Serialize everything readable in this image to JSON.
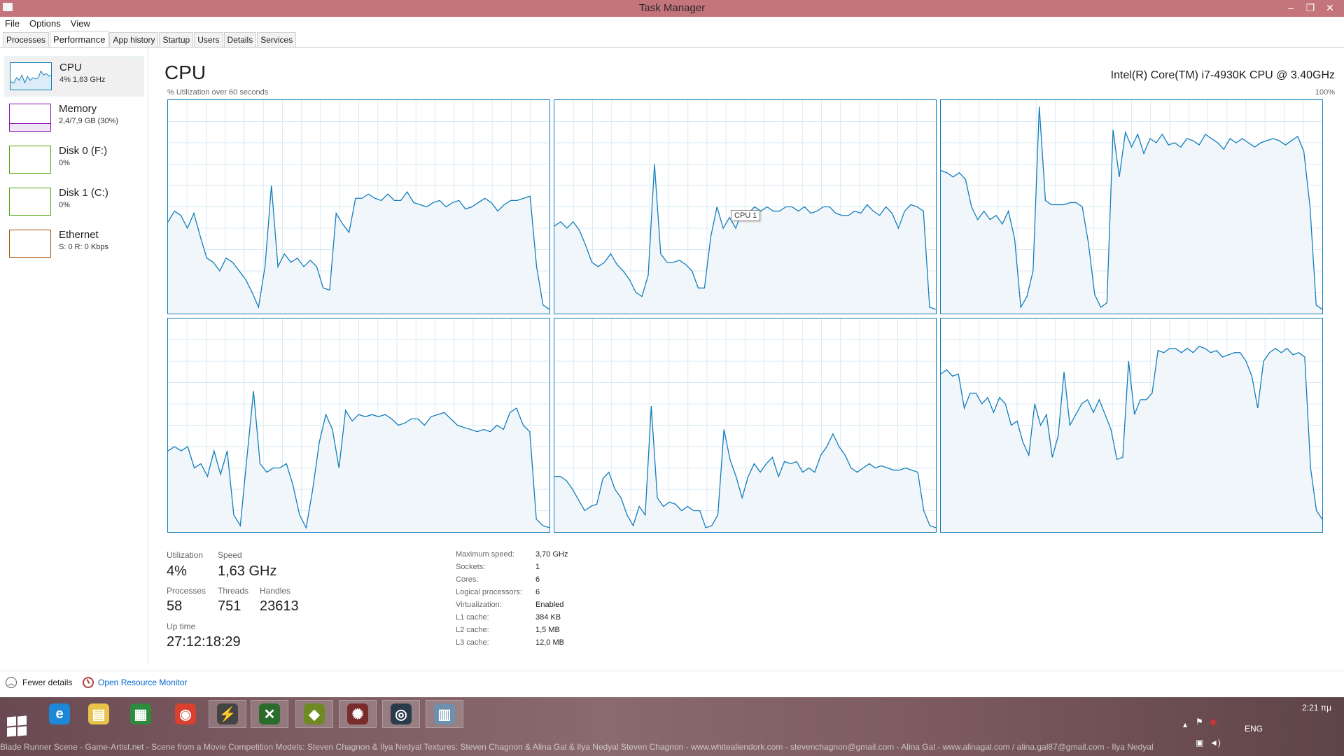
{
  "window": {
    "title": "Task Manager",
    "min": "–",
    "restore": "❐",
    "close": "✕"
  },
  "menu": [
    "File",
    "Options",
    "View"
  ],
  "tabs": [
    "Processes",
    "Performance",
    "App history",
    "Startup",
    "Users",
    "Details",
    "Services"
  ],
  "sidebar": {
    "items": [
      {
        "name": "CPU",
        "sub": "4% 1,63 GHz",
        "color": "#117dbb"
      },
      {
        "name": "Memory",
        "sub": "2,4/7,9 GB (30%)",
        "color": "#8b12ae"
      },
      {
        "name": "Disk 0 (F:)",
        "sub": "0%",
        "color": "#4da60c"
      },
      {
        "name": "Disk 1 (C:)",
        "sub": "0%",
        "color": "#4da60c"
      },
      {
        "name": "Ethernet",
        "sub": "S: 0 R: 0 Kbps",
        "color": "#a74f01"
      }
    ]
  },
  "main": {
    "title": "CPU",
    "model": "Intel(R) Core(TM) i7-4930K CPU @ 3.40GHz",
    "util_label": "% Utilization over 60 seconds",
    "max_label": "100%",
    "tooltip": "CPU 1"
  },
  "chart_data": {
    "type": "area",
    "ylim": [
      0,
      100
    ],
    "grid": true,
    "series": [
      {
        "name": "CPU 0",
        "values": [
          43,
          48,
          46,
          40,
          47,
          36,
          26,
          24,
          20,
          26,
          24,
          20,
          16,
          10,
          3,
          22,
          60,
          22,
          28,
          24,
          26,
          22,
          25,
          22,
          12,
          11,
          47,
          42,
          38,
          54,
          54,
          56,
          54,
          53,
          56,
          53,
          53,
          57,
          52,
          51,
          50,
          52,
          53,
          50,
          52,
          53,
          49,
          50,
          52,
          54,
          52,
          48,
          51,
          53,
          53,
          54,
          55,
          22,
          4,
          2
        ]
      },
      {
        "name": "CPU 1",
        "values": [
          41,
          43,
          40,
          43,
          39,
          32,
          24,
          22,
          24,
          28,
          23,
          20,
          16,
          10,
          8,
          18,
          70,
          28,
          24,
          24,
          25,
          23,
          20,
          12,
          12,
          36,
          50,
          40,
          45,
          40,
          48,
          47,
          50,
          48,
          50,
          48,
          48,
          50,
          50,
          48,
          50,
          47,
          48,
          50,
          50,
          47,
          46,
          46,
          48,
          47,
          51,
          48,
          46,
          50,
          47,
          40,
          48,
          51,
          50,
          48,
          3,
          2
        ]
      },
      {
        "name": "CPU 2",
        "values": [
          67,
          66,
          64,
          66,
          63,
          50,
          44,
          48,
          44,
          46,
          42,
          48,
          35,
          3,
          8,
          20,
          97,
          53,
          51,
          51,
          51,
          52,
          52,
          50,
          33,
          9,
          3,
          5,
          86,
          64,
          85,
          78,
          84,
          75,
          82,
          80,
          84,
          79,
          80,
          78,
          82,
          81,
          79,
          84,
          82,
          80,
          77,
          82,
          80,
          82,
          80,
          78,
          80,
          81,
          82,
          81,
          79,
          81,
          83,
          76,
          50,
          4,
          2
        ]
      },
      {
        "name": "CPU 3",
        "values": [
          38,
          40,
          38,
          40,
          30,
          32,
          26,
          38,
          27,
          38,
          8,
          3,
          35,
          66,
          32,
          28,
          30,
          30,
          32,
          22,
          8,
          2,
          20,
          42,
          55,
          48,
          30,
          57,
          52,
          55,
          54,
          55,
          54,
          55,
          53,
          50,
          51,
          53,
          53,
          50,
          54,
          55,
          56,
          53,
          50,
          49,
          48,
          47,
          48,
          47,
          50,
          48,
          56,
          58,
          50,
          47,
          6,
          3,
          2
        ]
      },
      {
        "name": "CPU 4",
        "values": [
          26,
          26,
          24,
          20,
          15,
          10,
          12,
          13,
          25,
          28,
          20,
          16,
          8,
          3,
          12,
          8,
          59,
          16,
          12,
          14,
          13,
          10,
          12,
          10,
          10,
          2,
          3,
          8,
          48,
          34,
          26,
          16,
          26,
          32,
          28,
          32,
          35,
          26,
          33,
          32,
          33,
          28,
          30,
          28,
          36,
          40,
          46,
          40,
          36,
          30,
          28,
          30,
          32,
          30,
          31,
          30,
          29,
          29,
          30,
          29,
          28,
          10,
          3,
          2
        ]
      },
      {
        "name": "CPU 5",
        "values": [
          74,
          76,
          73,
          74,
          58,
          65,
          65,
          60,
          63,
          56,
          63,
          60,
          50,
          52,
          42,
          36,
          60,
          50,
          55,
          35,
          45,
          75,
          50,
          55,
          60,
          62,
          56,
          62,
          55,
          48,
          34,
          35,
          80,
          55,
          62,
          62,
          65,
          85,
          84,
          86,
          86,
          84,
          86,
          84,
          87,
          86,
          84,
          85,
          82,
          83,
          84,
          84,
          80,
          73,
          58,
          80,
          84,
          86,
          84,
          86,
          83,
          84,
          82,
          30,
          10,
          6
        ]
      }
    ]
  },
  "stats": {
    "utilization_label": "Utilization",
    "utilization": "4%",
    "speed_label": "Speed",
    "speed": "1,63 GHz",
    "processes_label": "Processes",
    "processes": "58",
    "threads_label": "Threads",
    "threads": "751",
    "handles_label": "Handles",
    "handles": "23613",
    "uptime_label": "Up time",
    "uptime": "27:12:18:29"
  },
  "specs": [
    {
      "key": "Maximum speed:",
      "value": "3,70 GHz"
    },
    {
      "key": "Sockets:",
      "value": "1"
    },
    {
      "key": "Cores:",
      "value": "6"
    },
    {
      "key": "Logical processors:",
      "value": "6"
    },
    {
      "key": "Virtualization:",
      "value": "Enabled"
    },
    {
      "key": "L1 cache:",
      "value": "384 KB"
    },
    {
      "key": "L2 cache:",
      "value": "1,5 MB"
    },
    {
      "key": "L3 cache:",
      "value": "12,0 MB"
    }
  ],
  "footer": {
    "fewer_details": "Fewer details",
    "open_resource_monitor": "Open Resource Monitor"
  },
  "taskbar": {
    "icons": [
      {
        "name": "internet-explorer-icon",
        "glyph": "e",
        "color": "#1e88d8"
      },
      {
        "name": "file-explorer-icon",
        "glyph": "▤",
        "color": "#e8c24a"
      },
      {
        "name": "store-icon",
        "glyph": "▦",
        "color": "#2e8b3e"
      },
      {
        "name": "chrome-icon",
        "glyph": "◉",
        "color": "#d8402f"
      },
      {
        "name": "app-lightning-icon",
        "glyph": "⚡",
        "color": "#444"
      },
      {
        "name": "app-x-icon",
        "glyph": "✕",
        "color": "#2b6b2b"
      },
      {
        "name": "app-green-icon",
        "glyph": "◆",
        "color": "#6f8a22"
      },
      {
        "name": "app-bug-icon",
        "glyph": "✺",
        "color": "#7a2b2b"
      },
      {
        "name": "steam-icon",
        "glyph": "◎",
        "color": "#2a3b4c"
      },
      {
        "name": "task-manager-icon",
        "glyph": "▥",
        "color": "#6f8fae"
      }
    ],
    "caption": "Blade Runner Scene - Game-Artist.net - Scene from a Movie Competition     Models: Steven Chagnon & Ilya Nedyal     Textures: Steven Chagnon & Alina Gal & Ilya Nedyal     Steven Chagnon - www.whitealiendork.com - stevenchagnon@gmail.com - Alina Gal - www.alinagal.com / alina.gal87@gmail.com - Ilya Nedyal",
    "clock": "2:21 πμ",
    "lang": "ENG"
  }
}
